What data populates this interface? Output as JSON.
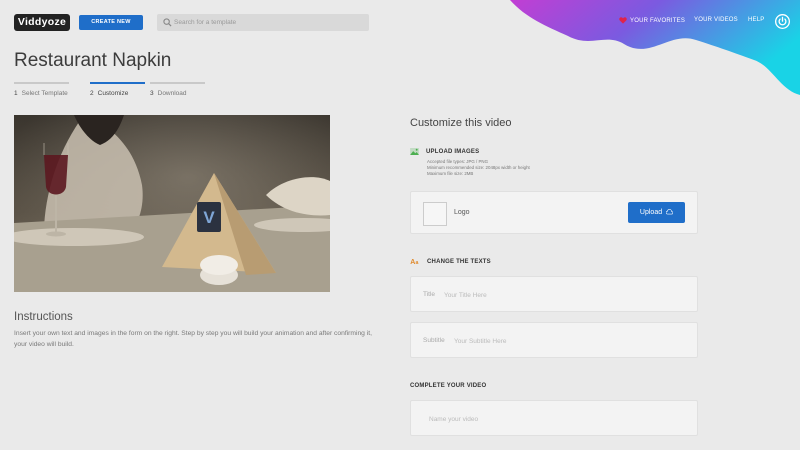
{
  "header": {
    "logo_text": "Viddyoze",
    "create_new_label": "CREATE NEW",
    "search_placeholder": "Search for a template",
    "favorites_label": "YOUR FAVORITES",
    "videos_label": "YOUR VIDEOS",
    "help_label": "HELP"
  },
  "page": {
    "title": "Restaurant Napkin"
  },
  "steps": [
    {
      "number": "1",
      "label": "Select Template",
      "active": false
    },
    {
      "number": "2",
      "label": "Customize",
      "active": true
    },
    {
      "number": "3",
      "label": "Download",
      "active": false
    }
  ],
  "preview": {
    "badge_letter": "V"
  },
  "instructions": {
    "title": "Instructions",
    "text": "Insert your own text and images in the form on the right. Step by step you will build your animation and after confirming it, your video will build."
  },
  "customize": {
    "title": "Customize this video",
    "upload_images": {
      "label": "UPLOAD IMAGES",
      "meta": [
        "Accepted file types: JPG / PNG",
        "Minimum recommended size: 2048px width or height",
        "Maximum file size: 2MB"
      ],
      "logo_label": "Logo",
      "upload_button": "Upload"
    },
    "change_texts": {
      "label": "CHANGE THE TEXTS",
      "fields": [
        {
          "label": "Title",
          "placeholder": "Your Title Here",
          "value": ""
        },
        {
          "label": "Subtitle",
          "placeholder": "Your Subtitle Here",
          "value": ""
        }
      ]
    },
    "complete": {
      "label": "COMPLETE YOUR VIDEO",
      "name_placeholder": "Name your video",
      "name_value": ""
    }
  },
  "colors": {
    "accent": "#1f6ec9",
    "background": "#eaeaea",
    "blob_start": "#c23ed3",
    "blob_end": "#19d3e6"
  }
}
